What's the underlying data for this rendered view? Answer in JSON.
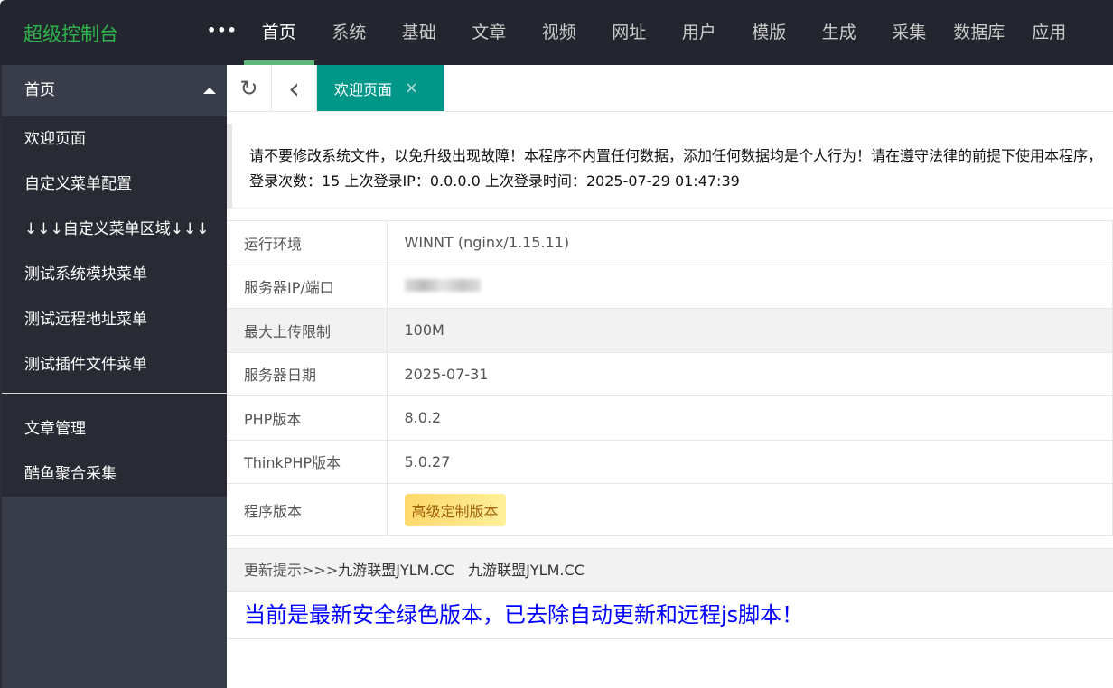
{
  "header": {
    "logo": "超级控制台",
    "more": "•••",
    "nav": [
      "首页",
      "系统",
      "基础",
      "文章",
      "视频",
      "网址",
      "用户",
      "模版",
      "生成",
      "采集",
      "数据库",
      "应用"
    ]
  },
  "sidebar": {
    "group": "首页",
    "items": [
      "欢迎页面",
      "自定义菜单配置",
      "↓↓↓自定义菜单区域↓↓↓",
      "测试系统模块菜单",
      "测试远程地址菜单",
      "测试插件文件菜单"
    ],
    "items2": [
      "文章管理",
      "酷鱼聚合采集"
    ]
  },
  "tabs": {
    "active": "欢迎页面",
    "close": "×",
    "refresh": "↻",
    "back": "‹"
  },
  "notice": {
    "line1": "请不要修改系统文件，以免升级出现故障！本程序不内置任何数据，添加任何数据均是个人行为！请在遵守法律的前提下使用本程序，",
    "line2": "登录次数：15 上次登录IP：0.0.0.0 上次登录时间：2025-07-29 01:47:39"
  },
  "info": [
    {
      "k": "运行环境",
      "v": "WINNT (nginx/1.15.11)"
    },
    {
      "k": "服务器IP/端口",
      "v": ""
    },
    {
      "k": "最大上传限制",
      "v": "100M"
    },
    {
      "k": "服务器日期",
      "v": "2025-07-31"
    },
    {
      "k": "PHP版本",
      "v": "8.0.2"
    },
    {
      "k": "ThinkPHP版本",
      "v": "5.0.27"
    },
    {
      "k": "程序版本",
      "v": "高级定制版本"
    }
  ],
  "update": {
    "prefix": "更新提示>>>",
    "link1": "九游联盟JYLM.CC",
    "link2": "九游联盟JYLM.CC",
    "message": "当前是最新安全绿色版本，已去除自动更新和远程js脚本！"
  }
}
